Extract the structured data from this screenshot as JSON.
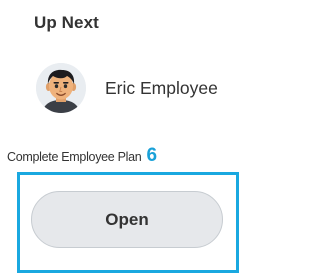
{
  "header": {
    "title": "Up Next"
  },
  "person": {
    "name": "Eric Employee",
    "avatar_icon": "male-avatar-icon"
  },
  "task": {
    "label": "Complete Employee Plan",
    "step_number": "6",
    "step_color": "#1aa1d8"
  },
  "action": {
    "open_label": "Open",
    "highlight_color": "#19a8e0"
  }
}
